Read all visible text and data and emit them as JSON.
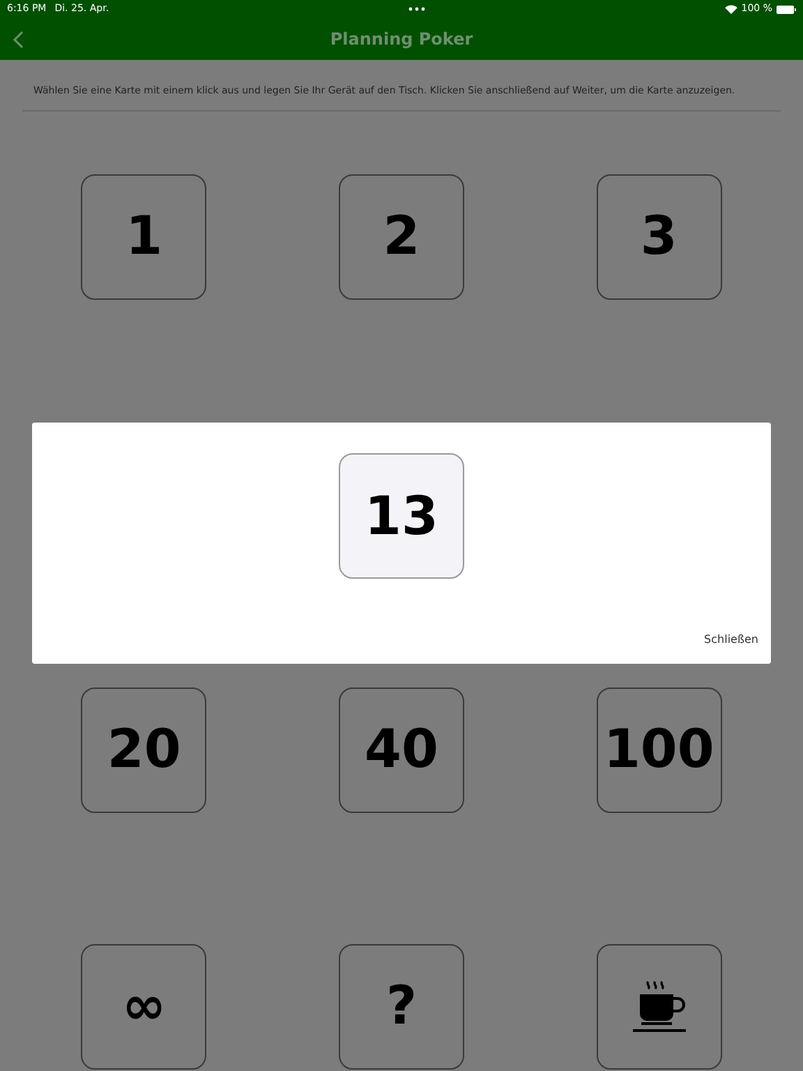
{
  "status_bar": {
    "time": "6:16 PM",
    "date": "Di. 25. Apr.",
    "battery": "100 %"
  },
  "nav": {
    "title": "Planning Poker"
  },
  "instruction": "Wählen Sie eine Karte mit einem klick aus und legen Sie Ihr Gerät auf den Tisch. Klicken Sie anschließend auf Weiter, um die Karte anzuzeigen.",
  "card_rows": [
    [
      {
        "kind": "text",
        "label": "1"
      },
      {
        "kind": "text",
        "label": "2"
      },
      {
        "kind": "text",
        "label": "3"
      }
    ],
    [
      {
        "kind": "text",
        "label": "20"
      },
      {
        "kind": "text",
        "label": "40"
      },
      {
        "kind": "text",
        "label": "100"
      }
    ],
    [
      {
        "kind": "text",
        "label": "∞"
      },
      {
        "kind": "text",
        "label": "?"
      },
      {
        "kind": "coffee"
      }
    ]
  ],
  "dialog": {
    "card": {
      "kind": "text",
      "label": "13"
    },
    "close_button": "Schließen"
  }
}
